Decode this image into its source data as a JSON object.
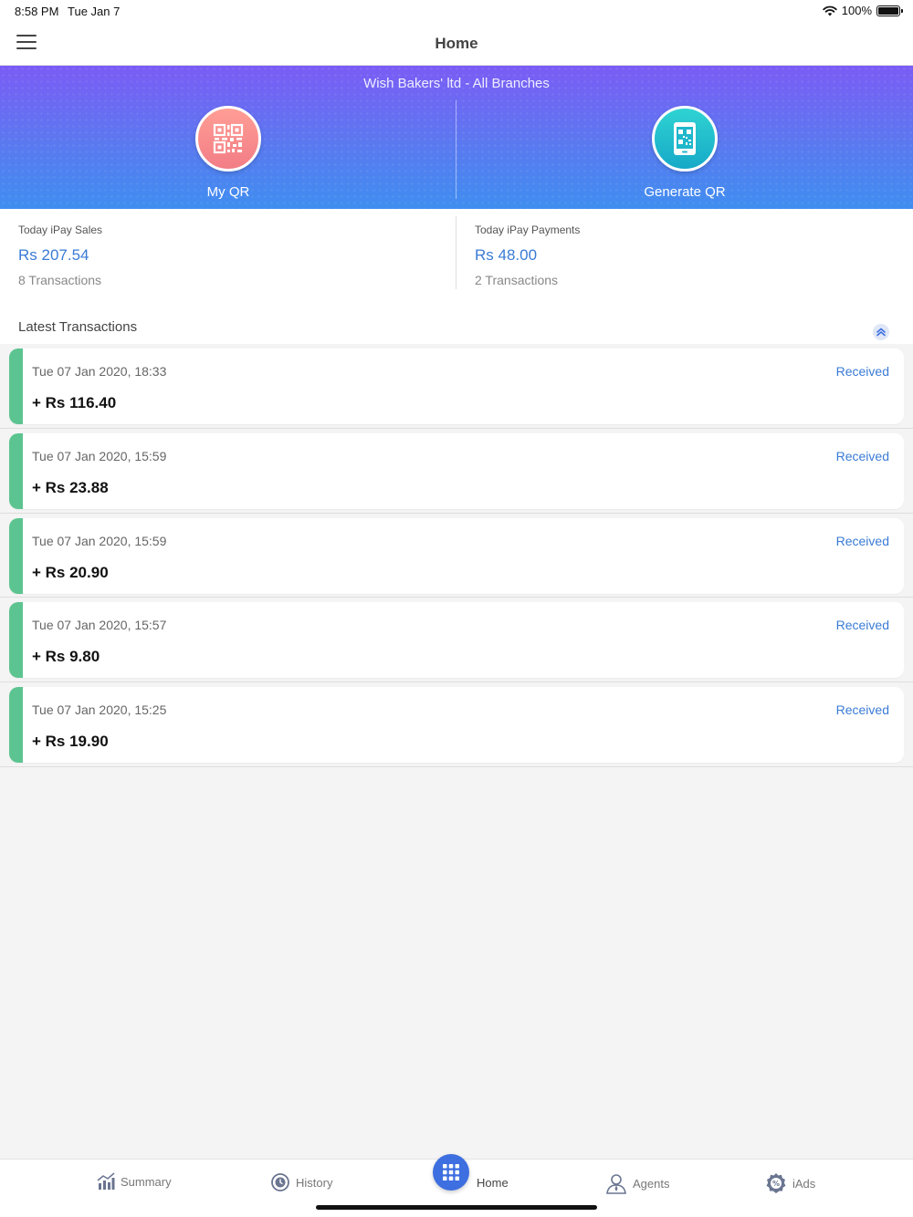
{
  "status_bar": {
    "time": "8:58 PM",
    "date": "Tue Jan 7",
    "battery": "100%"
  },
  "nav": {
    "title": "Home"
  },
  "banner": {
    "branch": "Wish Bakers' ltd - All Branches",
    "my_qr_label": "My QR",
    "generate_qr_label": "Generate QR"
  },
  "stats": {
    "sales": {
      "caption": "Today iPay Sales",
      "amount": "Rs 207.54",
      "count": "8 Transactions"
    },
    "payments": {
      "caption": "Today iPay Payments",
      "amount": "Rs 48.00",
      "count": "2 Transactions"
    }
  },
  "latest": {
    "heading": "Latest Transactions"
  },
  "transactions": [
    {
      "date": "Tue 07 Jan 2020, 18:33",
      "amount": "+ Rs 116.40",
      "status": "Received"
    },
    {
      "date": "Tue 07 Jan 2020, 15:59",
      "amount": "+ Rs 23.88",
      "status": "Received"
    },
    {
      "date": "Tue 07 Jan 2020, 15:59",
      "amount": "+ Rs 20.90",
      "status": "Received"
    },
    {
      "date": "Tue 07 Jan 2020, 15:57",
      "amount": "+ Rs 9.80",
      "status": "Received"
    },
    {
      "date": "Tue 07 Jan 2020, 15:25",
      "amount": "+ Rs 19.90",
      "status": "Received"
    }
  ],
  "tabs": {
    "summary": "Summary",
    "history": "History",
    "home": "Home",
    "agents": "Agents",
    "iads": "iAds"
  },
  "colors": {
    "accent": "#3a7bd5",
    "received_bar": "#5cc490",
    "banner_top": "#7b5cf5",
    "banner_bottom": "#3f8ef0"
  }
}
